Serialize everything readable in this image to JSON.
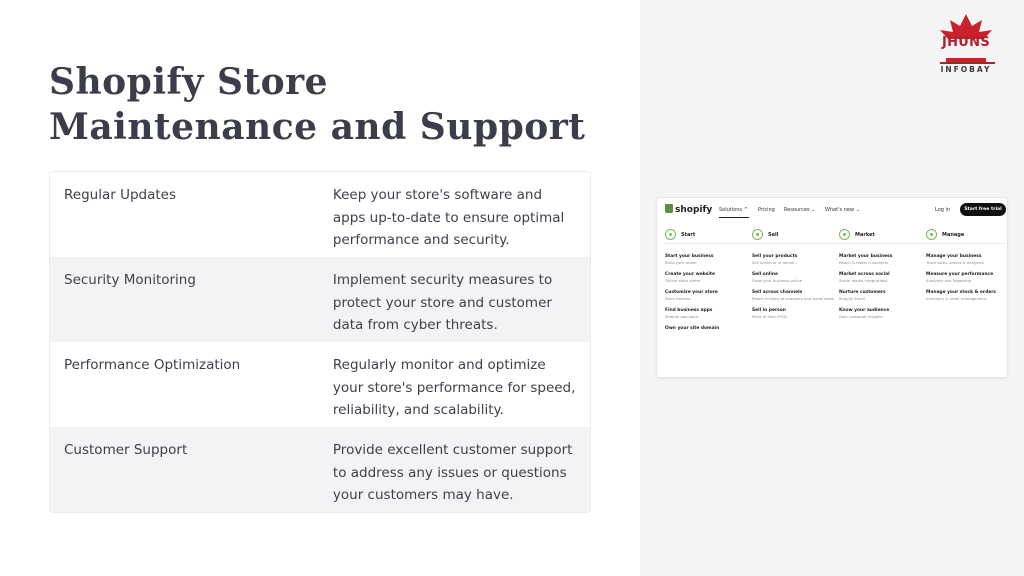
{
  "page": {
    "title": "Shopify Store Maintenance and Support"
  },
  "table": {
    "rows": [
      {
        "label": "Regular Updates",
        "description": "Keep your store's software and apps up-to-date to ensure optimal performance and security."
      },
      {
        "label": "Security Monitoring",
        "description": "Implement security measures to protect your store and customer data from cyber threats."
      },
      {
        "label": "Performance Optimization",
        "description": "Regularly monitor and optimize your store's performance for speed, reliability, and scalability."
      },
      {
        "label": "Customer Support",
        "description": "Provide excellent customer support to address any issues or questions your customers may have."
      }
    ]
  },
  "logo": {
    "name": "JHUNS",
    "sub": "INFOBAY",
    "color": "#b3202a"
  },
  "shopify_shot": {
    "brand": "shopify",
    "nav": [
      "Solutions ^",
      "Pricing",
      "Resources ⌄",
      "What's new ⌄"
    ],
    "login": "Log in",
    "cta": "Start free trial",
    "columns": [
      {
        "title": "Start",
        "items": [
          {
            "t": "Start your business",
            "s": "Build your brand"
          },
          {
            "t": "Create your website",
            "s": "Online store editor"
          },
          {
            "t": "Customize your store",
            "s": "Store themes"
          },
          {
            "t": "Find business apps",
            "s": "Shopify app store"
          },
          {
            "t": "Own your site domain",
            "s": ""
          }
        ]
      },
      {
        "title": "Sell",
        "items": [
          {
            "t": "Sell your products",
            "s": "Sell online or in person"
          },
          {
            "t": "Sell online",
            "s": "Grow your business online"
          },
          {
            "t": "Sell across channels",
            "s": "Reach millions of shoppers and boost sales"
          },
          {
            "t": "Sell in person",
            "s": "Point of Sale (POS)"
          }
        ]
      },
      {
        "title": "Market",
        "items": [
          {
            "t": "Market your business",
            "s": "Reach & retain customers"
          },
          {
            "t": "Market across social",
            "s": "Social media integrations"
          },
          {
            "t": "Nurture customers",
            "s": "Shopify Email"
          },
          {
            "t": "Know your audience",
            "s": "Gain customer insights"
          }
        ]
      },
      {
        "title": "Manage",
        "items": [
          {
            "t": "Manage your business",
            "s": "Track sales, orders & analytics"
          },
          {
            "t": "Measure your performance",
            "s": "Analytics and Reporting"
          },
          {
            "t": "Manage your stock & orders",
            "s": "Inventory & order management"
          }
        ]
      }
    ]
  }
}
